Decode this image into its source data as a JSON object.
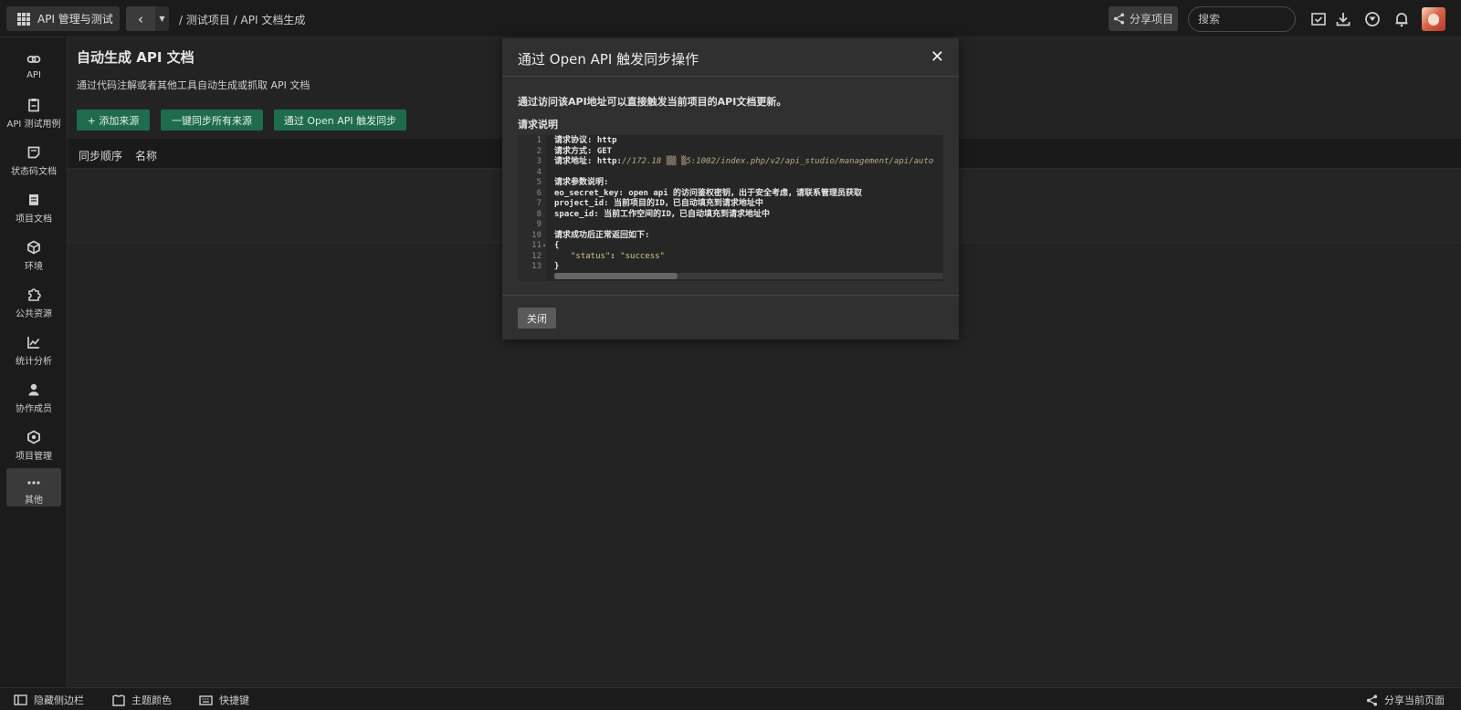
{
  "header": {
    "app_label": "API 管理与测试",
    "breadcrumb": "/ 测试项目 / API 文档生成",
    "share_label": "分享项目",
    "search_placeholder": "搜索"
  },
  "sidebar": {
    "items": [
      {
        "label": "API",
        "icon": "link-icon"
      },
      {
        "label": "API 测试用例",
        "icon": "clipboard-icon"
      },
      {
        "label": "状态码文档",
        "icon": "note-icon"
      },
      {
        "label": "项目文档",
        "icon": "document-icon"
      },
      {
        "label": "环境",
        "icon": "cube-icon"
      },
      {
        "label": "公共资源",
        "icon": "puzzle-icon"
      },
      {
        "label": "统计分析",
        "icon": "chart-icon"
      },
      {
        "label": "协作成员",
        "icon": "user-icon"
      },
      {
        "label": "项目管理",
        "icon": "gear-icon"
      },
      {
        "label": "其他",
        "icon": "more-icon"
      }
    ]
  },
  "main": {
    "title": "自动生成 API 文档",
    "description": "通过代码注解或者其他工具自动生成或抓取 API 文档",
    "buttons": {
      "add_source": "+ 添加来源",
      "sync_all": "一键同步所有来源",
      "open_api_sync": "通过 Open API 触发同步"
    },
    "table": {
      "columns": [
        "同步顺序",
        "名称"
      ]
    }
  },
  "modal": {
    "title": "通过 Open API 触发同步操作",
    "intro": "通过访问该API地址可以直接触发当前项目的API文档更新。",
    "subtitle": "请求说明",
    "code": {
      "line1": "请求协议: http",
      "line2": "请求方式: GET",
      "line3_prefix": "请求地址: http:",
      "line3_url": "//172.18 ▒▒ ▒5:1002/index.php/v2/api_studio/management/api/auto",
      "line5": "请求参数说明:",
      "line6": "eo_secret_key: open api 的访问鉴权密钥，出于安全考虑，请联系管理员获取",
      "line7": "project_id: 当前项目的ID，已自动填充到请求地址中",
      "line8": "space_id: 当前工作空间的ID，已自动填充到请求地址中",
      "line10": "请求成功后正常返回如下:",
      "line11": "{",
      "line12_key": "\"status\"",
      "line12_sep": ": ",
      "line12_val": "\"success\"",
      "line13": "}"
    },
    "close_label": "关闭"
  },
  "bottombar": {
    "hide_sidebar": "隐藏侧边栏",
    "theme_color": "主题颜色",
    "shortcuts": "快捷键",
    "share_page": "分享当前页面"
  },
  "colors": {
    "accent_green": "#1e6b4e",
    "background": "#232323",
    "modal": "#303030"
  }
}
